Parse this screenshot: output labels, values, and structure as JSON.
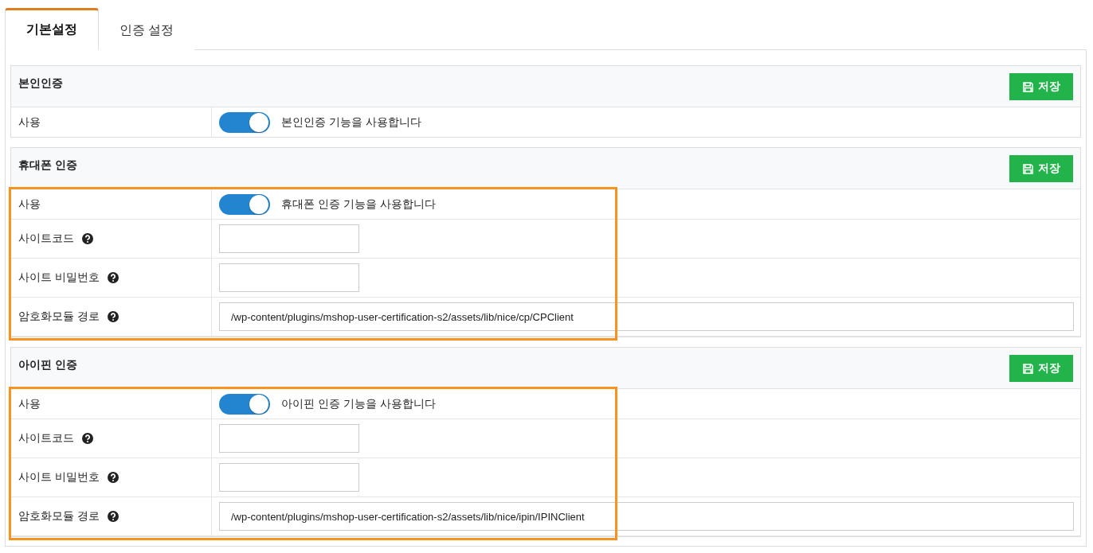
{
  "tabs": [
    {
      "label": "기본설정",
      "selected": true
    },
    {
      "label": "인증 설정",
      "selected": false
    }
  ],
  "sections": [
    {
      "title": "본인인증",
      "save_button": "저장",
      "highlighted": false,
      "rows": [
        {
          "kind": "toggle",
          "label": "사용",
          "help": false,
          "on": true,
          "text": "본인인증 기능을 사용합니다"
        }
      ]
    },
    {
      "title": "휴대폰 인증",
      "save_button": "저장",
      "highlighted": true,
      "rows": [
        {
          "kind": "toggle",
          "label": "사용",
          "help": false,
          "on": true,
          "text": "휴대폰 인증 기능을 사용합니다"
        },
        {
          "kind": "input",
          "label": "사이트코드",
          "help": true
        },
        {
          "kind": "input",
          "label": "사이트 비밀번호",
          "help": true
        },
        {
          "kind": "path",
          "label": "암호화모듈 경로",
          "help": true,
          "value": "/wp-content/plugins/mshop-user-certification-s2/assets/lib/nice/cp/CPClient"
        }
      ]
    },
    {
      "title": "아이핀 인증",
      "save_button": "저장",
      "highlighted": true,
      "rows": [
        {
          "kind": "toggle",
          "label": "사용",
          "help": false,
          "on": true,
          "text": "아이핀 인증 기능을 사용합니다"
        },
        {
          "kind": "input",
          "label": "사이트코드",
          "help": true
        },
        {
          "kind": "input",
          "label": "사이트 비밀번호",
          "help": true
        },
        {
          "kind": "path",
          "label": "암호화모듈 경로",
          "help": true,
          "value": "/wp-content/plugins/mshop-user-certification-s2/assets/lib/nice/ipin/IPINClient"
        }
      ]
    }
  ]
}
